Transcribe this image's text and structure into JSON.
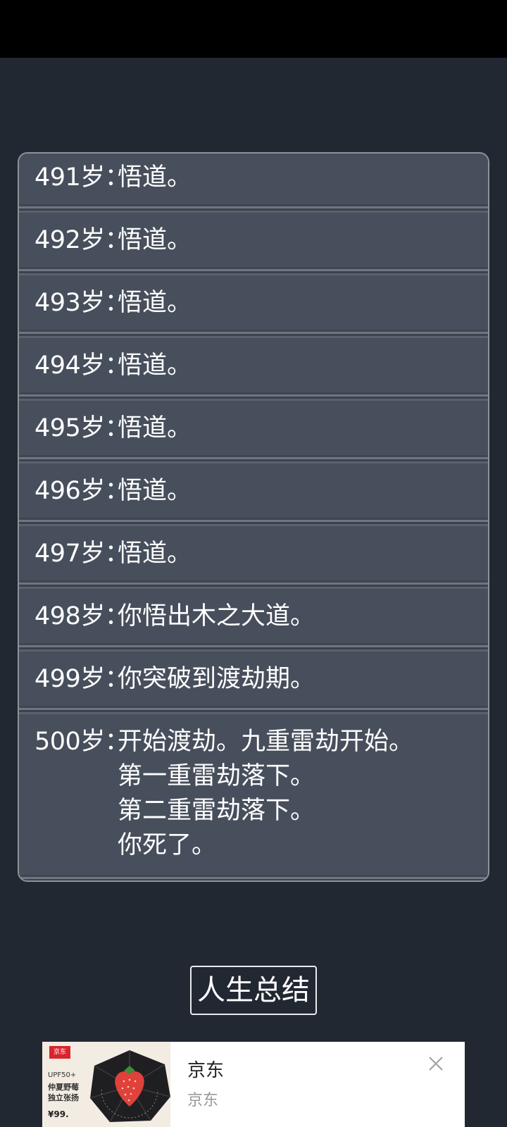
{
  "log": {
    "entries": [
      {
        "age": "491岁：",
        "text": "悟道。"
      },
      {
        "age": "492岁：",
        "text": "悟道。"
      },
      {
        "age": "493岁：",
        "text": "悟道。"
      },
      {
        "age": "494岁：",
        "text": "悟道。"
      },
      {
        "age": "495岁：",
        "text": "悟道。"
      },
      {
        "age": "496岁：",
        "text": "悟道。"
      },
      {
        "age": "497岁：",
        "text": "悟道。"
      },
      {
        "age": "498岁：",
        "text": "你悟出木之大道。"
      },
      {
        "age": "499岁：",
        "text": "你突破到渡劫期。"
      },
      {
        "age": "500岁：",
        "text": "开始渡劫。九重雷劫开始。\n第一重雷劫落下。\n第二重雷劫落下。\n你死了。"
      }
    ]
  },
  "summary_button": {
    "label": "人生总结"
  },
  "ad": {
    "title": "京东",
    "subtitle": "京东",
    "image_text": {
      "badge": "京东",
      "line1": "UPF50+",
      "line2": "仲夏野莓",
      "line3": "独立张扬",
      "price": "¥99."
    },
    "close_icon": "close-icon"
  },
  "colors": {
    "background": "#222832",
    "panel": "#474f5c",
    "panel_border": "#8d939b",
    "text": "#ffffff"
  }
}
